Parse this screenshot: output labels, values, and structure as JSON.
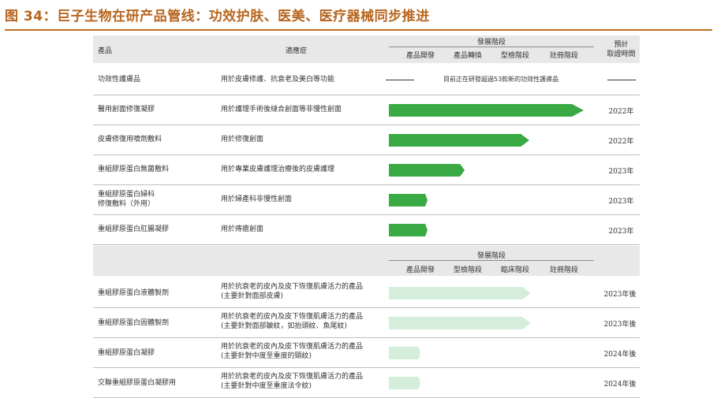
{
  "page": {
    "title": "图 34：巨子生物在研产品管线：功效护肤、医美、医疗器械同步推进"
  },
  "colors": {
    "title": "#b8651e",
    "bar_dark": "#3aaa45",
    "bar_light": "#d5eedb",
    "header_bg": "#e8e8e8"
  },
  "table1": {
    "header": {
      "product": "產品",
      "indication": "適應症",
      "stage_group": "發展階段",
      "stages": [
        "產品開發",
        "產品轉換",
        "型檢階段",
        "註冊階段"
      ],
      "expected_time": "預計\n取證時間"
    },
    "rows": [
      {
        "product": "功效性護膚品",
        "indication": "用於皮膚修護、抗衰老及美白等功能",
        "note": "目前正在研發超過53款新的功效性護膚品",
        "time": "",
        "progress": null
      },
      {
        "product": "醫用創面修復凝膠",
        "indication": "用於護理手術後縫合創面等非慢性創面",
        "time": "2022年",
        "progress": 1.0
      },
      {
        "product": "皮膚修復用噴劑敷料",
        "indication": "用於修復創面",
        "time": "2022年",
        "progress": 0.72
      },
      {
        "product": "重組膠原蛋白無菌敷料",
        "indication": "用於專業皮膚護理治療後的皮膚護理",
        "time": "2023年",
        "progress": 0.39
      },
      {
        "product": "重組膠原蛋白婦科\n修復敷料（外用）",
        "indication": "用於婦產科非慢性創面",
        "time": "2023年",
        "progress": 0.2
      },
      {
        "product": "重組膠原蛋白肛腸凝膠",
        "indication": "用於痔瘡創面",
        "time": "2023年",
        "progress": 0.2
      }
    ]
  },
  "table2": {
    "header": {
      "stage_group": "發展階段",
      "stages": [
        "產品開發",
        "型檢階段",
        "臨床階段",
        "註冊階段"
      ]
    },
    "rows": [
      {
        "product": "重組膠原蛋白液體製劑",
        "indication": "用於抗衰老的皮內及皮下恢復肌膚活力的產品\n(主要針對面部皮膚)",
        "time": "2023年後",
        "progress": 0.73
      },
      {
        "product": "重組膠原蛋白固體製劑",
        "indication": "用於抗衰老的皮內及皮下恢復肌膚活力的產品\n(主要針對面部皺紋，如抬頭紋、魚尾紋)",
        "time": "2023年後",
        "progress": 0.73
      },
      {
        "product": "重組膠原蛋白凝膠",
        "indication": "用於抗衰老的皮內及皮下恢復肌膚活力的產品\n(主要針對中度至重度的頸紋)",
        "time": "2024年後",
        "progress": 0.16
      },
      {
        "product": "交聯重組膠原蛋白凝膠用",
        "indication": "用於抗衰老的皮內及皮下恢復肌膚活力的產品\n(主要針對中度至重度法令紋)",
        "time": "2024年後",
        "progress": 0.16
      }
    ]
  }
}
